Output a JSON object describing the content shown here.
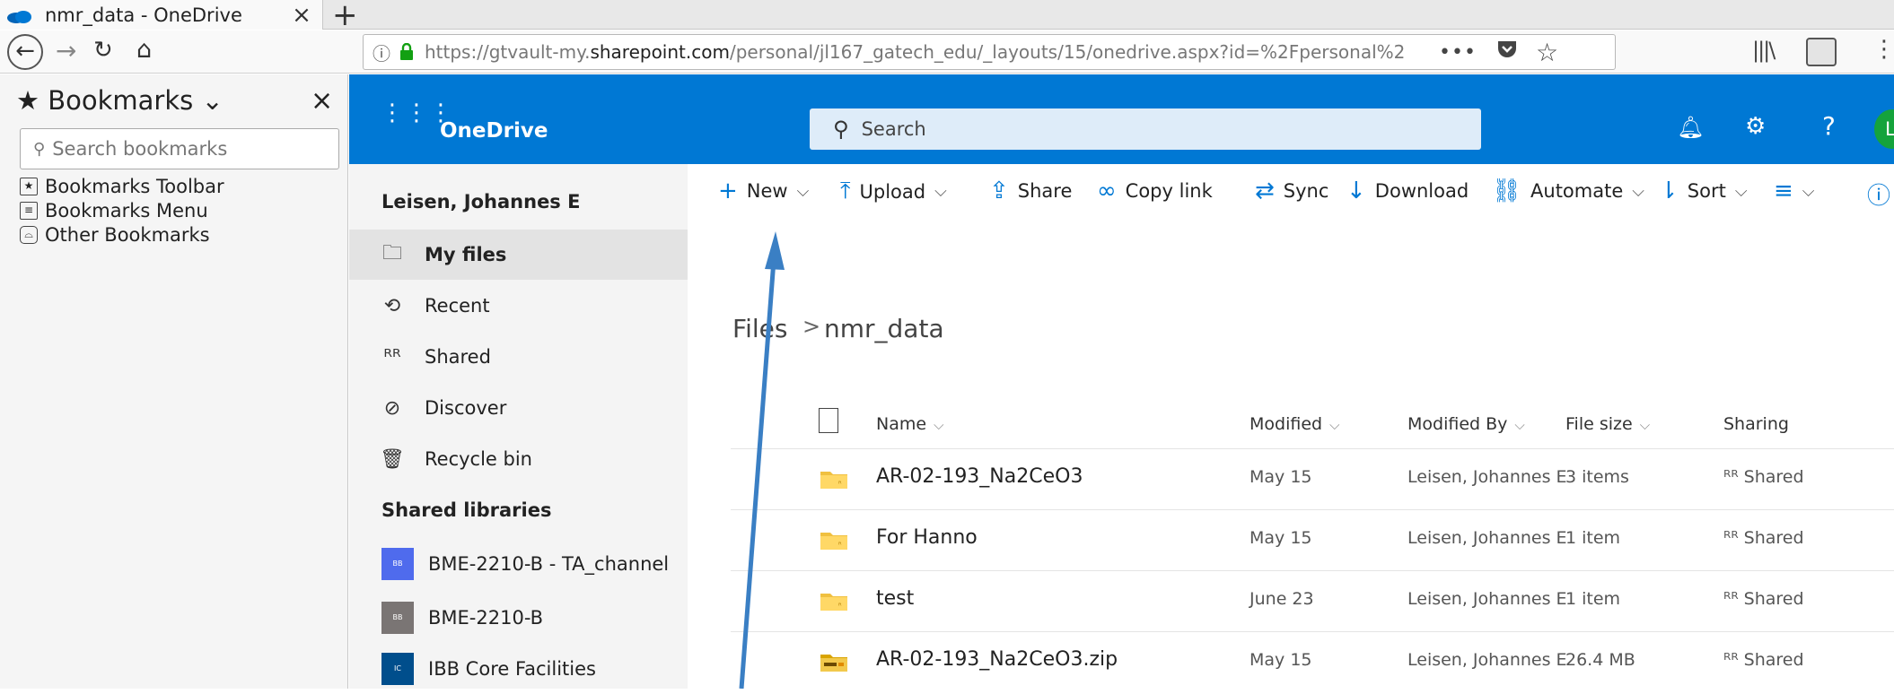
{
  "browser": {
    "tab_title": "nmr_data - OneDrive",
    "tab_close": "×",
    "new_tab": "+",
    "url_prefix": "https://gtvault-my.",
    "url_domain": "sharepoint.com",
    "url_suffix": "/personal/jl167_gatech_edu/_layouts/15/onedrive.aspx?id=%2Fpersonal%2",
    "page_actions": "•••"
  },
  "bookmarks_sidebar": {
    "title": "Bookmarks",
    "close": "×",
    "search_placeholder": "Search bookmarks",
    "items": [
      {
        "label": "Bookmarks Toolbar",
        "icon": "star-box-icon"
      },
      {
        "label": "Bookmarks Menu",
        "icon": "list-box-icon"
      },
      {
        "label": "Other Bookmarks",
        "icon": "tray-icon"
      }
    ]
  },
  "onedrive": {
    "brand": "OneDrive",
    "search_placeholder": "Search",
    "avatar_initial": "L",
    "accent": "#0078d4",
    "user_name": "Leisen, Johannes E",
    "nav": [
      {
        "label": "My files",
        "icon": "folder-icon",
        "active": true
      },
      {
        "label": "Recent",
        "icon": "clock-icon"
      },
      {
        "label": "Shared",
        "icon": "people-icon"
      },
      {
        "label": "Discover",
        "icon": "compass-icon"
      },
      {
        "label": "Recycle bin",
        "icon": "recycle-bin-icon"
      }
    ],
    "shared_libraries_title": "Shared libraries",
    "libraries": [
      {
        "label": "BME-2210-B - TA_channel",
        "badge": "BB",
        "color": "#4f6bed"
      },
      {
        "label": "BME-2210-B",
        "badge": "BB",
        "color": "#7a7574"
      },
      {
        "label": "IBB Core Facilities",
        "badge": "IC",
        "color": "#004e8c"
      }
    ],
    "commands": {
      "new": "New",
      "upload": "Upload",
      "share": "Share",
      "copy_link": "Copy link",
      "sync": "Sync",
      "download": "Download",
      "automate": "Automate",
      "sort": "Sort"
    },
    "breadcrumb": {
      "root": "Files",
      "separator": ">",
      "current": "nmr_data"
    },
    "columns": {
      "name": "Name",
      "modified": "Modified",
      "modified_by": "Modified By",
      "file_size": "File size",
      "sharing": "Sharing"
    },
    "files": [
      {
        "name": "AR-02-193_Na2CeO3",
        "modified": "May 15",
        "modified_by": "Leisen, Johannes E",
        "size": "3 items",
        "sharing": "Shared",
        "type": "folder"
      },
      {
        "name": "For Hanno",
        "modified": "May 15",
        "modified_by": "Leisen, Johannes E",
        "size": "1 item",
        "sharing": "Shared",
        "type": "folder"
      },
      {
        "name": "test",
        "modified": "June 23",
        "modified_by": "Leisen, Johannes E",
        "size": "1 item",
        "sharing": "Shared",
        "type": "folder"
      },
      {
        "name": "AR-02-193_Na2CeO3.zip",
        "modified": "May 15",
        "modified_by": "Leisen, Johannes E",
        "size": "26.4 MB",
        "sharing": "Shared",
        "type": "zip"
      }
    ]
  }
}
